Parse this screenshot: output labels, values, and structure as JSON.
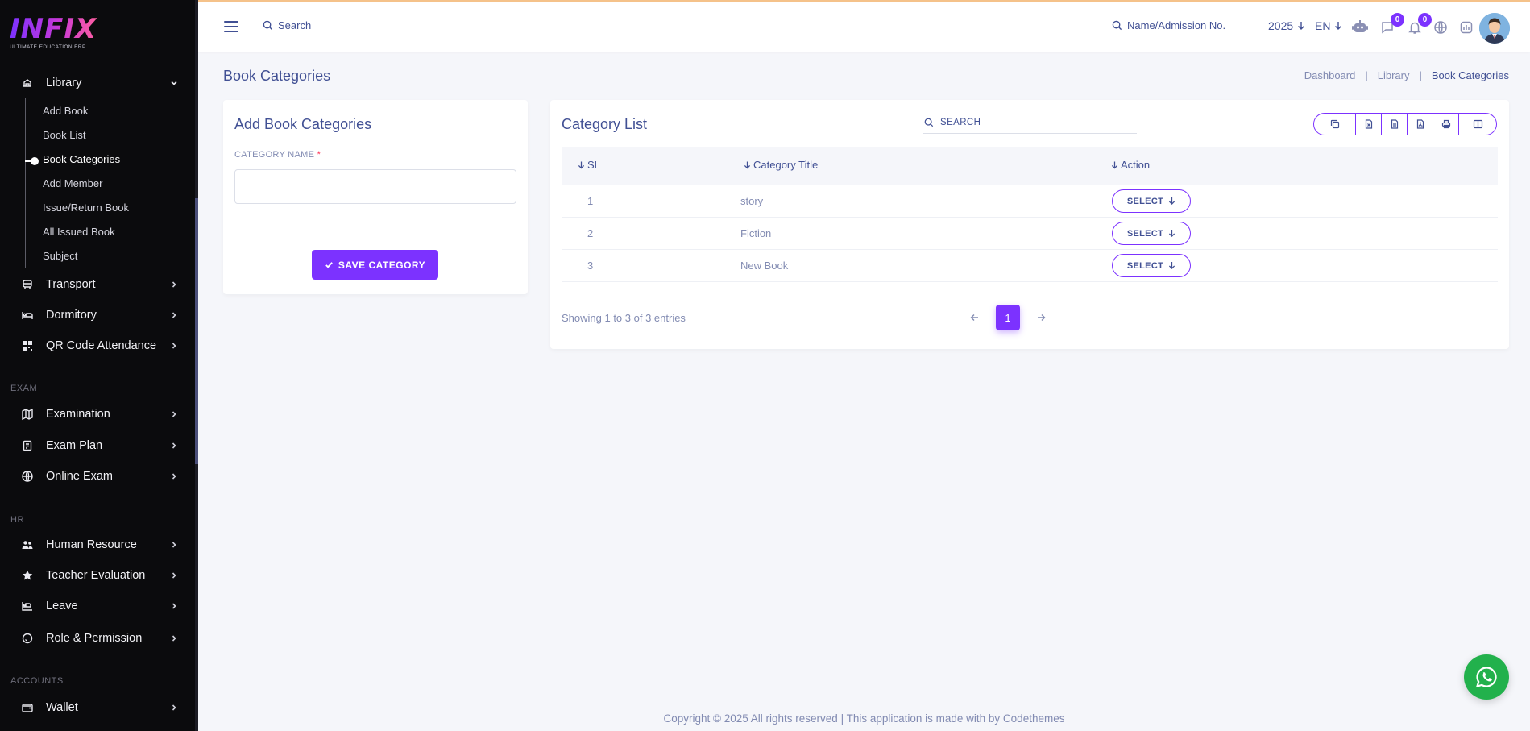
{
  "brand": {
    "logo_text": "INFIX",
    "tagline": "ULTIMATE EDUCATION ERP"
  },
  "colors": {
    "accent": "#7c32ff",
    "primary_text": "#415094",
    "muted_text": "#828bb2",
    "sidebar_bg": "#0b0b0d",
    "whatsapp": "#22b14c"
  },
  "sidebar": {
    "library": {
      "label": "Library",
      "icon": "library-icon",
      "expanded": true,
      "sub_items": [
        "Add Book",
        "Book List",
        "Book Categories",
        "Add Member",
        "Issue/Return Book",
        "All Issued Book",
        "Subject"
      ],
      "active": "Book Categories"
    },
    "menu_a": [
      {
        "label": "Transport",
        "icon": "bus-icon"
      },
      {
        "label": "Dormitory",
        "icon": "bed-icon"
      },
      {
        "label": "QR Code Attendance",
        "icon": "qr-code-icon"
      }
    ],
    "section_exam": "EXAM",
    "menu_exam": [
      {
        "label": "Examination",
        "icon": "map-icon"
      },
      {
        "label": "Exam Plan",
        "icon": "clipboard-icon"
      },
      {
        "label": "Online Exam",
        "icon": "globe-icon"
      }
    ],
    "section_hr": "HR",
    "menu_hr": [
      {
        "label": "Human Resource",
        "icon": "users-icon"
      },
      {
        "label": "Teacher Evaluation",
        "icon": "star-icon"
      },
      {
        "label": "Leave",
        "icon": "leave-icon"
      },
      {
        "label": "Role & Permission",
        "icon": "role-icon"
      }
    ],
    "section_accounts": "ACCOUNTS",
    "menu_accounts": [
      {
        "label": "Wallet",
        "icon": "wallet-icon"
      }
    ]
  },
  "topbar": {
    "search_label": "Search",
    "student_search_label": "Name/Admission No.",
    "year": "2025",
    "language": "EN",
    "chat_badge": "0",
    "notification_badge": "0"
  },
  "page": {
    "title": "Book Categories",
    "breadcrumb": [
      "Dashboard",
      "Library",
      "Book Categories"
    ]
  },
  "form": {
    "title": "Add Book Categories",
    "field_label": "CATEGORY NAME",
    "required_mark": "*",
    "field_value": "",
    "submit_label": "SAVE CATEGORY"
  },
  "list": {
    "title": "Category List",
    "search_placeholder": "SEARCH",
    "tools": [
      "copy-icon",
      "excel-icon",
      "csv-icon",
      "pdf-icon",
      "print-icon",
      "columns-icon"
    ],
    "columns": [
      "SL",
      "Category Title",
      "Action"
    ],
    "rows": [
      {
        "sl": "1",
        "title": "story",
        "action": "SELECT"
      },
      {
        "sl": "2",
        "title": "Fiction",
        "action": "SELECT"
      },
      {
        "sl": "3",
        "title": "New Book",
        "action": "SELECT"
      }
    ],
    "showing": "Showing 1 to 3 of 3 entries",
    "current_page": "1"
  },
  "footer": {
    "text": "Copyright © 2025 All rights reserved | This application is made with by Codethemes"
  }
}
